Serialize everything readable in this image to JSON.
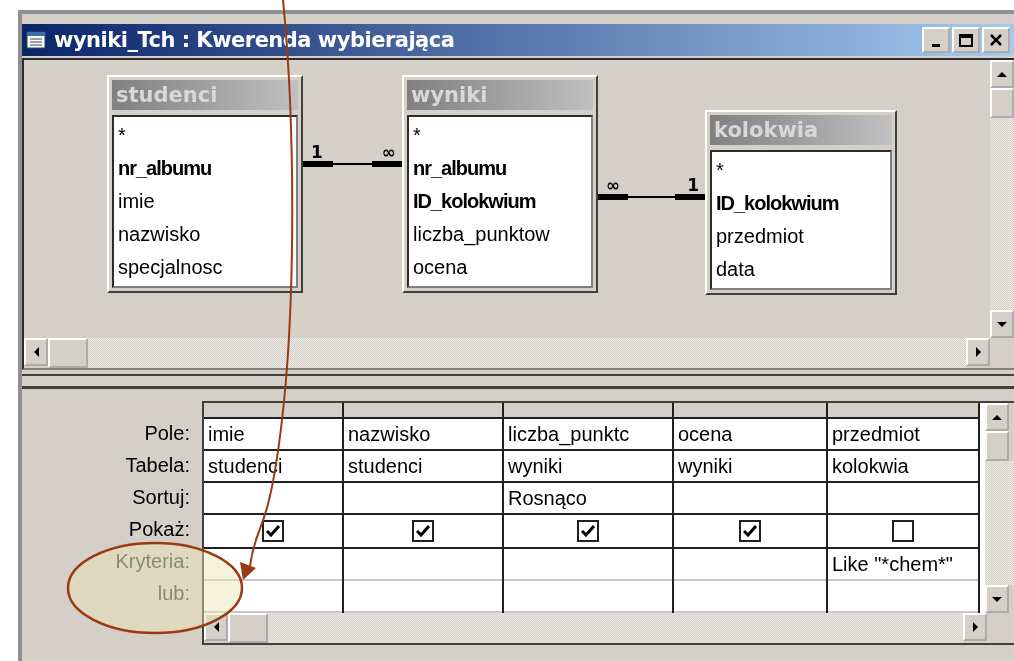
{
  "window": {
    "title": "wyniki_Tch : Kwerenda wybierająca"
  },
  "tables": [
    {
      "name": "studenci",
      "fields": [
        {
          "name": "*",
          "primary_key": false
        },
        {
          "name": "nr_albumu",
          "primary_key": true
        },
        {
          "name": "imie",
          "primary_key": false
        },
        {
          "name": "nazwisko",
          "primary_key": false
        },
        {
          "name": "specjalnosc",
          "primary_key": false
        }
      ]
    },
    {
      "name": "wyniki",
      "fields": [
        {
          "name": "*",
          "primary_key": false
        },
        {
          "name": "nr_albumu",
          "primary_key": true
        },
        {
          "name": "ID_kolokwium",
          "primary_key": true
        },
        {
          "name": "liczba_punktow",
          "primary_key": false
        },
        {
          "name": "ocena",
          "primary_key": false
        }
      ]
    },
    {
      "name": "kolokwia",
      "fields": [
        {
          "name": "*",
          "primary_key": false
        },
        {
          "name": "ID_kolokwium",
          "primary_key": true
        },
        {
          "name": "przedmiot",
          "primary_key": false
        },
        {
          "name": "data",
          "primary_key": false
        }
      ]
    }
  ],
  "relations": [
    {
      "left_label": "1",
      "right_label": "∞"
    },
    {
      "left_label": "∞",
      "right_label": "1"
    }
  ],
  "grid": {
    "row_labels": [
      "Pole:",
      "Tabela:",
      "Sortuj:",
      "Pokaż:",
      "Kryteria:",
      "lub:"
    ],
    "columns": [
      {
        "field": "imie",
        "table": "studenci",
        "show": true
      },
      {
        "field": "nazwisko",
        "table": "studenci",
        "show": true
      },
      {
        "field": "liczba_punktc",
        "table": "wyniki",
        "sort": "Rosnąco",
        "show": true
      },
      {
        "field": "ocena",
        "table": "wyniki",
        "show": true
      },
      {
        "field": "przedmiot",
        "table": "kolokwia",
        "show": false,
        "criteria": "Like \"*chem*\""
      }
    ]
  }
}
